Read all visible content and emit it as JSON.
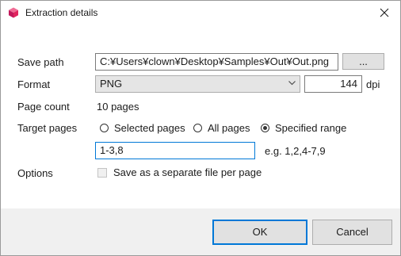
{
  "window": {
    "title": "Extraction details"
  },
  "form": {
    "save_path": {
      "label": "Save path",
      "value": "C:¥Users¥clown¥Desktop¥Samples¥Out¥Out.png",
      "browse_label": "..."
    },
    "format": {
      "label": "Format",
      "selected": "PNG",
      "dpi_value": "144",
      "dpi_unit": "dpi"
    },
    "page_count": {
      "label": "Page count",
      "value": "10 pages"
    },
    "target_pages": {
      "label": "Target pages",
      "options": [
        {
          "label": "Selected pages",
          "selected": false
        },
        {
          "label": "All pages",
          "selected": false
        },
        {
          "label": "Specified range",
          "selected": true
        }
      ],
      "range_value": "1-3,8",
      "range_hint": "e.g. 1,2,4-7,9"
    },
    "options": {
      "label": "Options",
      "separate_file_label": "Save as a separate file per page",
      "separate_file_checked": false,
      "separate_file_enabled": false
    }
  },
  "footer": {
    "ok_label": "OK",
    "cancel_label": "Cancel"
  },
  "colors": {
    "accent": "#0078d7",
    "footer_bg": "#f0f0f0",
    "button_bg": "#e1e1e1",
    "app_icon": "#e0245e"
  },
  "icons": {
    "app": "app-logo-icon",
    "close": "close-icon",
    "dropdown": "chevron-down-icon"
  }
}
